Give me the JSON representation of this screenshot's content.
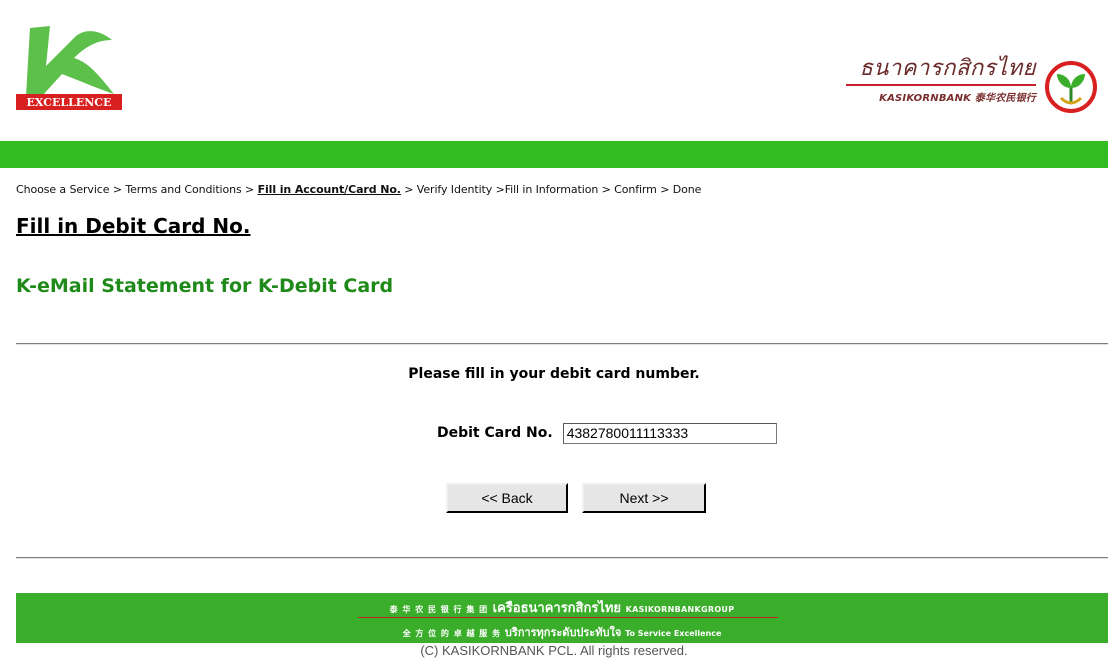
{
  "header": {
    "logo_left_text": "EXCELLENCE",
    "bank_name_thai": "ธนาคารกสิกรไทย",
    "bank_name_en": "KASIKORNBANK 泰华农民银行",
    "brand_green": "#33bb22",
    "brand_red": "#c8202a"
  },
  "breadcrumb": {
    "step1": "Choose a Service",
    "step2": "Terms and Conditions",
    "step3": "Fill in Account/Card No.",
    "step4": "Verify Identity",
    "step5": "Fill in Information",
    "step6": "Confirm",
    "step7": "Done"
  },
  "main": {
    "page_title": "Fill in Debit Card No.",
    "section_title": "K-eMail Statement for K-Debit Card",
    "instruction": "Please fill in your debit card number.",
    "card_label": "Debit Card No.",
    "card_value": "4382780011113333",
    "back_label": "<< Back",
    "next_label": "Next >>"
  },
  "footer": {
    "line1_deco": "泰 华 农 民 银 行 集 团",
    "line1_thai": "เครือธนาคารกสิกรไทย",
    "line1_en": "KASIKORNBANKGROUP",
    "line2_deco": "全 方 位 的 卓 越 服 务",
    "line2_thai": "บริการทุกระดับประทับใจ",
    "line2_en": "To Service Excellence",
    "copyright": "(C) KASIKORNBANK PCL. All rights reserved."
  }
}
